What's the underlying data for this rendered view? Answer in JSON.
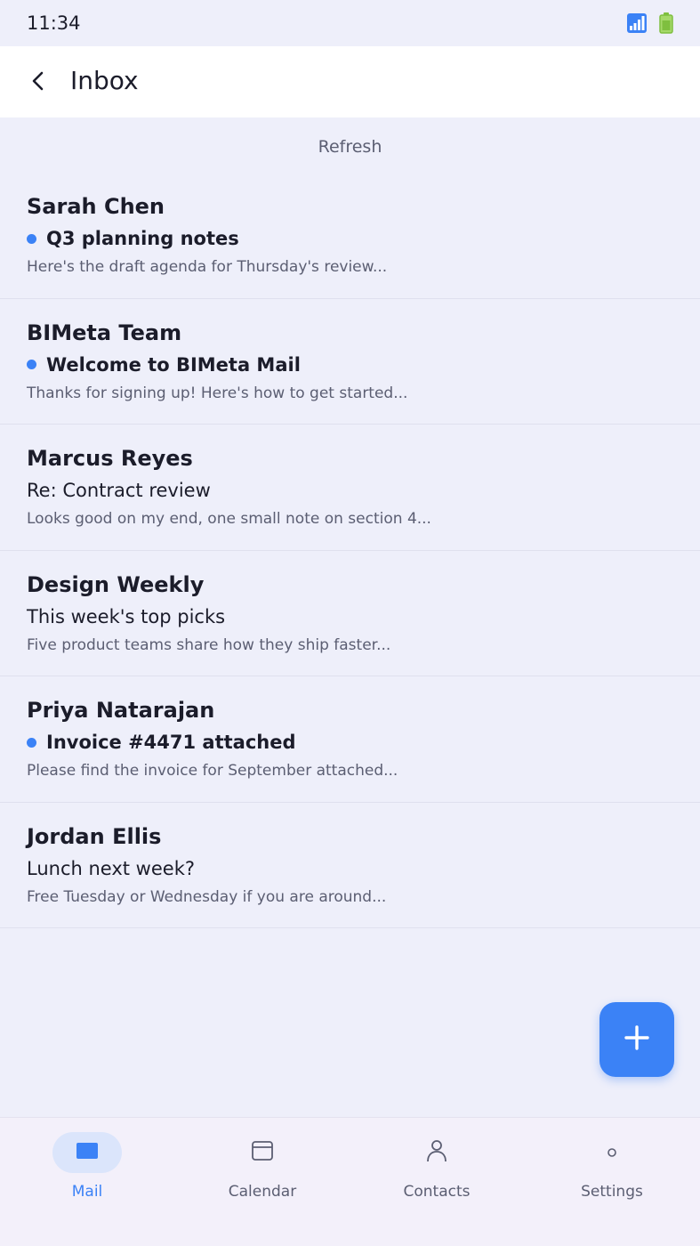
{
  "status_bar": {
    "time": "11:34",
    "icons": [
      "signal-icon",
      "battery-icon"
    ]
  },
  "app_bar": {
    "title": "Inbox",
    "back_icon": "chevron-left-icon"
  },
  "refresh_label": "Refresh",
  "messages": [
    {
      "sender": "Sarah Chen",
      "subject": "Q3 planning notes",
      "preview": "Here's the draft agenda for Thursday's review...",
      "unread": true
    },
    {
      "sender": "BIMeta Team",
      "subject": "Welcome to BIMeta Mail",
      "preview": "Thanks for signing up! Here's how to get started...",
      "unread": true
    },
    {
      "sender": "Marcus Reyes",
      "subject": "Re: Contract review",
      "preview": "Looks good on my end, one small note on section 4...",
      "unread": false
    },
    {
      "sender": "Design Weekly",
      "subject": "This week's top picks",
      "preview": "Five product teams share how they ship faster...",
      "unread": false
    },
    {
      "sender": "Priya Natarajan",
      "subject": "Invoice #4471 attached",
      "preview": "Please find the invoice for September attached...",
      "unread": true
    },
    {
      "sender": "Jordan Ellis",
      "subject": "Lunch next week?",
      "preview": "Free Tuesday or Wednesday if you are around...",
      "unread": false
    }
  ],
  "fab": {
    "icon": "plus-icon"
  },
  "bottom_nav": {
    "items": [
      {
        "label": "Mail",
        "icon": "mail-icon",
        "active": true
      },
      {
        "label": "Calendar",
        "icon": "calendar-icon",
        "active": false
      },
      {
        "label": "Contacts",
        "icon": "person-icon",
        "active": false
      },
      {
        "label": "Settings",
        "icon": "settings-icon",
        "active": false
      }
    ]
  },
  "colors": {
    "accent": "#3b82f6",
    "background": "#eeeffa",
    "text_primary": "#1b1c2a",
    "text_secondary": "#5b5e72"
  }
}
